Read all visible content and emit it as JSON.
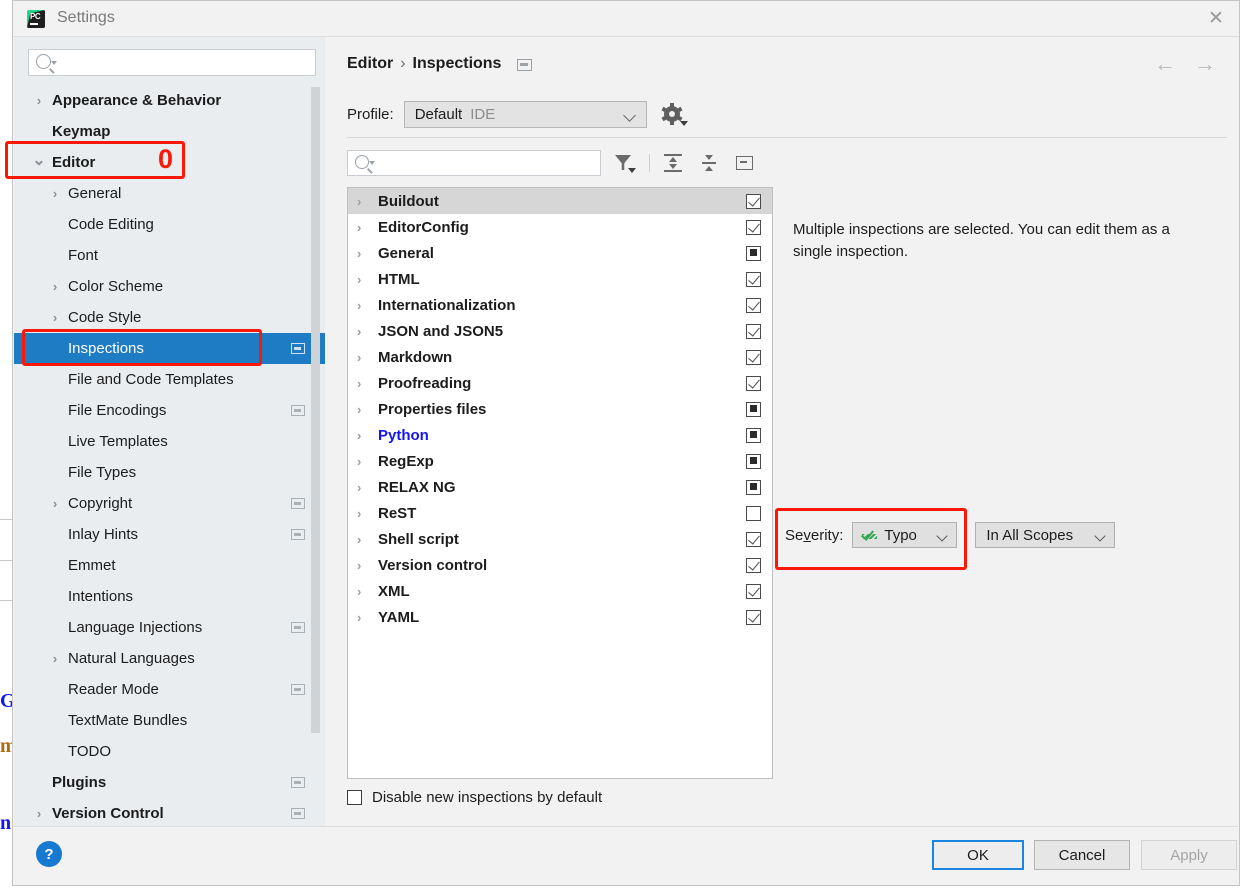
{
  "window": {
    "title": "Settings",
    "app_icon": "pycharm-icon",
    "close_icon": "close-icon"
  },
  "sidebar": {
    "search_placeholder": "",
    "search_icon": "search-icon",
    "items": [
      {
        "label": "Appearance & Behavior",
        "indent": 0,
        "chevron": "collapsed",
        "bold": true,
        "badge": false,
        "selected": false
      },
      {
        "label": "Keymap",
        "indent": 0,
        "chevron": "none",
        "bold": true,
        "badge": false,
        "selected": false
      },
      {
        "label": "Editor",
        "indent": 0,
        "chevron": "expanded",
        "bold": true,
        "badge": false,
        "selected": false
      },
      {
        "label": "General",
        "indent": 1,
        "chevron": "collapsed",
        "bold": false,
        "badge": false,
        "selected": false
      },
      {
        "label": "Code Editing",
        "indent": 1,
        "chevron": "none",
        "bold": false,
        "badge": false,
        "selected": false
      },
      {
        "label": "Font",
        "indent": 1,
        "chevron": "none",
        "bold": false,
        "badge": false,
        "selected": false
      },
      {
        "label": "Color Scheme",
        "indent": 1,
        "chevron": "collapsed",
        "bold": false,
        "badge": false,
        "selected": false
      },
      {
        "label": "Code Style",
        "indent": 1,
        "chevron": "collapsed",
        "bold": false,
        "badge": false,
        "selected": false
      },
      {
        "label": "Inspections",
        "indent": 1,
        "chevron": "none",
        "bold": false,
        "badge": true,
        "selected": true
      },
      {
        "label": "File and Code Templates",
        "indent": 1,
        "chevron": "none",
        "bold": false,
        "badge": false,
        "selected": false
      },
      {
        "label": "File Encodings",
        "indent": 1,
        "chevron": "none",
        "bold": false,
        "badge": true,
        "selected": false
      },
      {
        "label": "Live Templates",
        "indent": 1,
        "chevron": "none",
        "bold": false,
        "badge": false,
        "selected": false
      },
      {
        "label": "File Types",
        "indent": 1,
        "chevron": "none",
        "bold": false,
        "badge": false,
        "selected": false
      },
      {
        "label": "Copyright",
        "indent": 1,
        "chevron": "collapsed",
        "bold": false,
        "badge": true,
        "selected": false
      },
      {
        "label": "Inlay Hints",
        "indent": 1,
        "chevron": "none",
        "bold": false,
        "badge": true,
        "selected": false
      },
      {
        "label": "Emmet",
        "indent": 1,
        "chevron": "none",
        "bold": false,
        "badge": false,
        "selected": false
      },
      {
        "label": "Intentions",
        "indent": 1,
        "chevron": "none",
        "bold": false,
        "badge": false,
        "selected": false
      },
      {
        "label": "Language Injections",
        "indent": 1,
        "chevron": "none",
        "bold": false,
        "badge": true,
        "selected": false
      },
      {
        "label": "Natural Languages",
        "indent": 1,
        "chevron": "collapsed",
        "bold": false,
        "badge": false,
        "selected": false
      },
      {
        "label": "Reader Mode",
        "indent": 1,
        "chevron": "none",
        "bold": false,
        "badge": true,
        "selected": false
      },
      {
        "label": "TextMate Bundles",
        "indent": 1,
        "chevron": "none",
        "bold": false,
        "badge": false,
        "selected": false
      },
      {
        "label": "TODO",
        "indent": 1,
        "chevron": "none",
        "bold": false,
        "badge": false,
        "selected": false
      },
      {
        "label": "Plugins",
        "indent": 0,
        "chevron": "none",
        "bold": true,
        "badge": true,
        "selected": false
      },
      {
        "label": "Version Control",
        "indent": 0,
        "chevron": "collapsed",
        "bold": true,
        "badge": true,
        "selected": false
      }
    ]
  },
  "content": {
    "breadcrumb": {
      "parent": "Editor",
      "separator": "›",
      "current": "Inspections",
      "badge_icon": "project-scope-icon"
    },
    "nav": {
      "back_icon": "arrow-left-icon",
      "forward_icon": "arrow-right-icon"
    },
    "profile": {
      "label": "Profile:",
      "value": "Default",
      "value_suffix": "IDE",
      "dropdown_icon": "chevron-down-icon",
      "gear_icon": "gear-icon"
    },
    "toolbar": {
      "search_placeholder": "",
      "search_icon": "search-icon",
      "filter_icon": "filter-icon",
      "expand_all_icon": "expand-all-icon",
      "collapse_all_icon": "collapse-all-icon",
      "show_panel_icon": "show-panel-icon"
    },
    "inspections": [
      {
        "label": "Buildout",
        "state": "checked",
        "selected": true,
        "modified": false
      },
      {
        "label": "EditorConfig",
        "state": "checked",
        "selected": false,
        "modified": false
      },
      {
        "label": "General",
        "state": "partial",
        "selected": false,
        "modified": false
      },
      {
        "label": "HTML",
        "state": "checked",
        "selected": false,
        "modified": false
      },
      {
        "label": "Internationalization",
        "state": "checked",
        "selected": false,
        "modified": false
      },
      {
        "label": "JSON and JSON5",
        "state": "checked",
        "selected": false,
        "modified": false
      },
      {
        "label": "Markdown",
        "state": "checked",
        "selected": false,
        "modified": false
      },
      {
        "label": "Proofreading",
        "state": "checked",
        "selected": false,
        "modified": false
      },
      {
        "label": "Properties files",
        "state": "partial",
        "selected": false,
        "modified": false
      },
      {
        "label": "Python",
        "state": "partial",
        "selected": false,
        "modified": true
      },
      {
        "label": "RegExp",
        "state": "partial",
        "selected": false,
        "modified": false
      },
      {
        "label": "RELAX NG",
        "state": "partial",
        "selected": false,
        "modified": false
      },
      {
        "label": "ReST",
        "state": "unchecked",
        "selected": false,
        "modified": false
      },
      {
        "label": "Shell script",
        "state": "checked",
        "selected": false,
        "modified": false
      },
      {
        "label": "Version control",
        "state": "checked",
        "selected": false,
        "modified": false
      },
      {
        "label": "XML",
        "state": "checked",
        "selected": false,
        "modified": false
      },
      {
        "label": "YAML",
        "state": "checked",
        "selected": false,
        "modified": false
      }
    ],
    "disable_new": {
      "label": "Disable new inspections by default",
      "checked": false
    },
    "detail_message": "Multiple inspections are selected. You can edit them as a single inspection.",
    "severity": {
      "label_prefix": "Se",
      "label_mnemonic": "v",
      "label_suffix": "erity:",
      "value": "Typo",
      "icon": "typo-squiggle-icon",
      "dropdown_icon": "chevron-down-icon",
      "scope_value": "In All Scopes",
      "scope_dropdown_icon": "chevron-down-icon"
    }
  },
  "footer": {
    "help_icon": "help-icon",
    "help_label": "?",
    "ok_label": "OK",
    "cancel_label": "Cancel",
    "apply_label": "Apply"
  },
  "annotations": [
    {
      "number": "0",
      "target": "editor-sidebar-item"
    }
  ],
  "colors": {
    "selection_blue": "#1e7cc4",
    "annotation_red": "#fc1706",
    "modified_blue": "#1414f0",
    "sidebar_bg": "#e9edf0",
    "dialog_bg": "#f2f2f2",
    "typo_green": "#3aa655"
  }
}
